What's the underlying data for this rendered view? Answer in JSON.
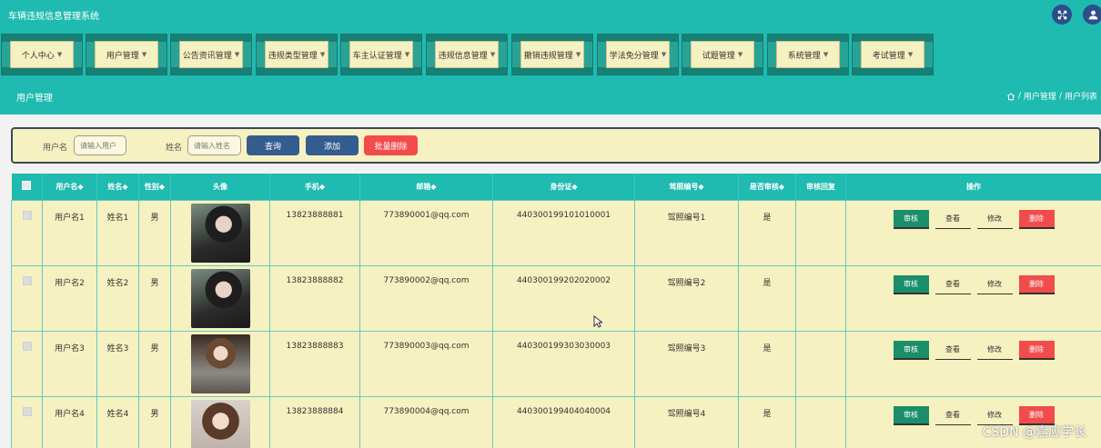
{
  "app": {
    "title": "车辆违规信息管理系统"
  },
  "nav": {
    "items": [
      {
        "label": "个人中心"
      },
      {
        "label": "用户管理"
      },
      {
        "label": "公告资讯管理"
      },
      {
        "label": "违规类型管理"
      },
      {
        "label": "车主认证管理"
      },
      {
        "label": "违规信息管理"
      },
      {
        "label": "撤销违规管理"
      },
      {
        "label": "学法免分管理"
      },
      {
        "label": "试题管理"
      },
      {
        "label": "系统管理"
      },
      {
        "label": "考试管理"
      }
    ]
  },
  "breadcrumb": {
    "title": "用户管理",
    "crumb1": "用户管理",
    "crumb2": "用户列表",
    "sep": "/"
  },
  "search": {
    "username_label": "用户名",
    "username_placeholder": "请输入用户",
    "name_label": "姓名",
    "name_placeholder": "请输入姓名",
    "query_btn": "查询",
    "add_btn": "添加",
    "batch_delete_btn": "批量删除"
  },
  "table": {
    "headers": [
      "用户名◆",
      "姓名◆",
      "性别◆",
      "头像",
      "手机◆",
      "邮箱◆",
      "身份证◆",
      "驾照编号◆",
      "是否审核◆",
      "审核回复",
      "操作"
    ],
    "rows": [
      {
        "username": "用户名1",
        "name": "姓名1",
        "gender": "男",
        "phone": "13823888881",
        "email": "773890001@qq.com",
        "idcard": "440300199101010001",
        "license": "驾照编号1",
        "audited": "是",
        "reply": ""
      },
      {
        "username": "用户名2",
        "name": "姓名2",
        "gender": "男",
        "phone": "13823888882",
        "email": "773890002@qq.com",
        "idcard": "440300199202020002",
        "license": "驾照编号2",
        "audited": "是",
        "reply": ""
      },
      {
        "username": "用户名3",
        "name": "姓名3",
        "gender": "男",
        "phone": "13823888883",
        "email": "773890003@qq.com",
        "idcard": "440300199303030003",
        "license": "驾照编号3",
        "audited": "是",
        "reply": ""
      },
      {
        "username": "用户名4",
        "name": "姓名4",
        "gender": "男",
        "phone": "13823888884",
        "email": "773890004@qq.com",
        "idcard": "440300199404040004",
        "license": "驾照编号4",
        "audited": "是",
        "reply": ""
      }
    ],
    "ops": {
      "audit": "审核",
      "view": "查看",
      "edit": "修改",
      "delete": "删除"
    }
  },
  "watermark": "CSDN @嘉应学长",
  "colors": {
    "teal": "#1fbab0",
    "cream": "#f6f1c0",
    "blue_btn": "#355c8e",
    "red_btn": "#f24b4b",
    "audit_btn": "#1a8f6a"
  }
}
